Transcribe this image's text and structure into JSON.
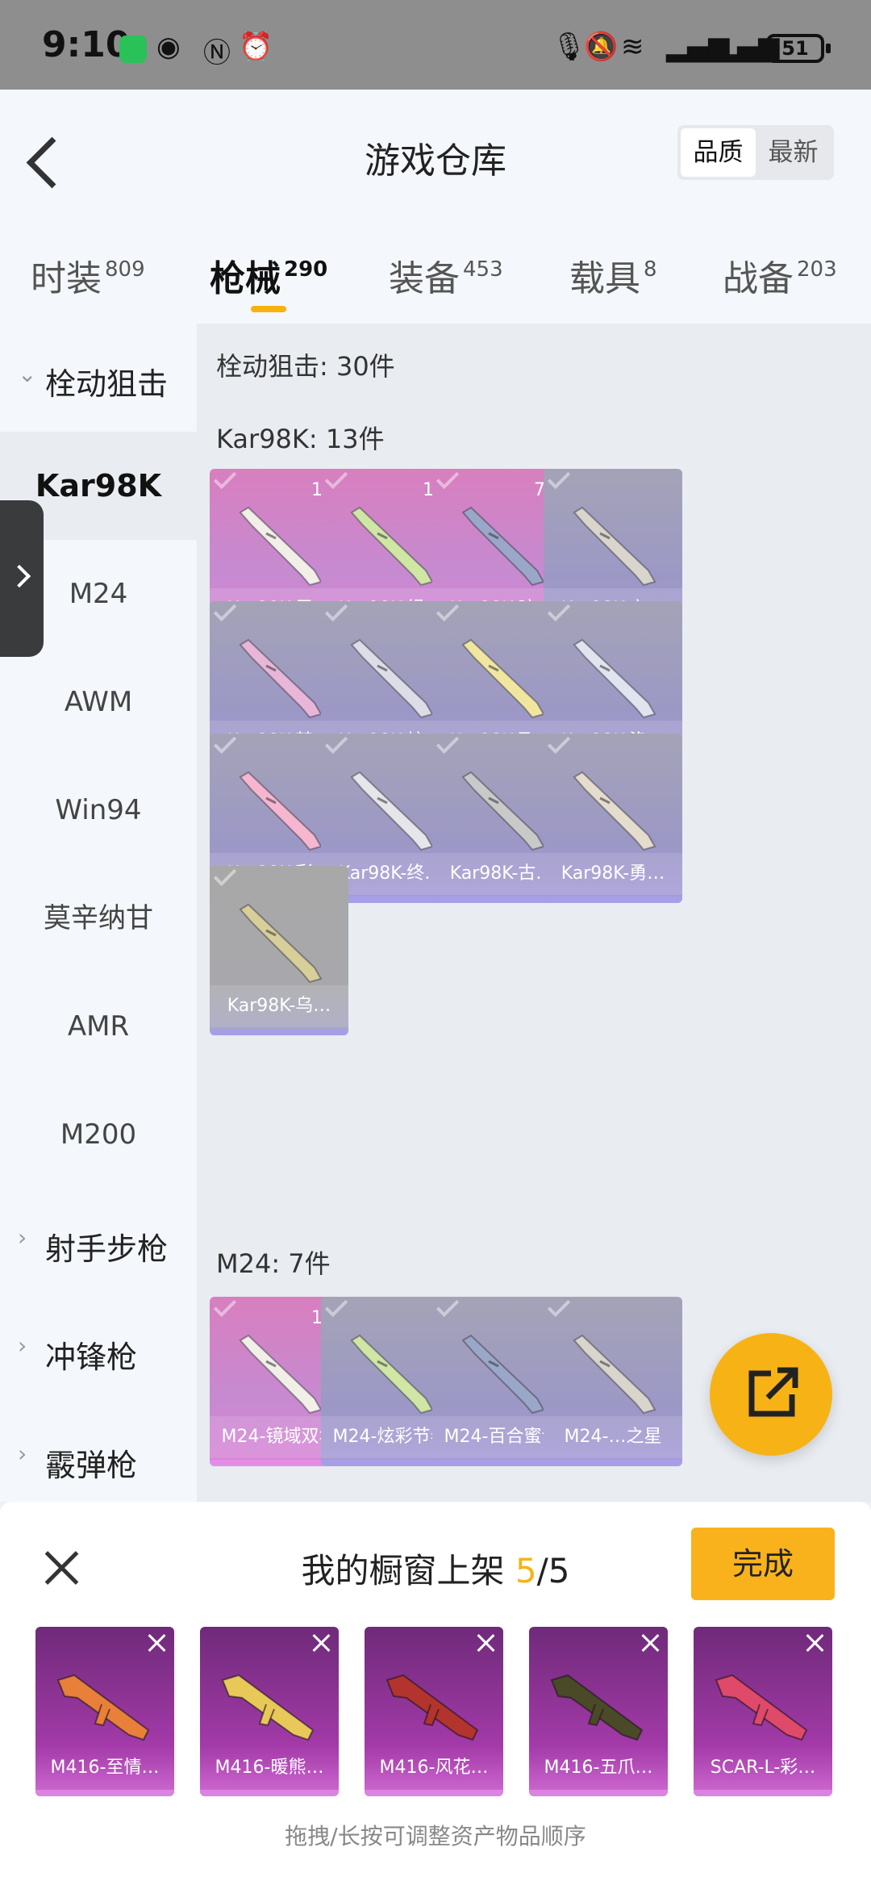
{
  "status_bar": {
    "time": "9:10",
    "battery": "51"
  },
  "header": {
    "title": "游戏仓库",
    "sort": [
      "品质",
      "最新"
    ]
  },
  "tabs": [
    {
      "label": "时装",
      "count": "809"
    },
    {
      "label": "枪械",
      "count": "290"
    },
    {
      "label": "装备",
      "count": "453"
    },
    {
      "label": "载具",
      "count": "8"
    },
    {
      "label": "战备",
      "count": "203"
    }
  ],
  "sidebar": {
    "group_open": "栓动狙击",
    "items": [
      "Kar98K",
      "M24",
      "AWM",
      "Win94",
      "莫辛纳甘",
      "AMR",
      "M200"
    ],
    "groups_closed": [
      "射手步枪",
      "冲锋枪",
      "霰弹枪"
    ]
  },
  "main": {
    "category_header": "栓动狙击: 30件",
    "kar_header": "Kar98K: 13件",
    "m24_header": "M24: 7件",
    "kar_items": [
      {
        "name": "Kar98K-巴…",
        "level": "1级"
      },
      {
        "name": "Kar98K-绿…",
        "level": "1级"
      },
      {
        "name": "Kar98K-暗…",
        "level": "7级"
      },
      {
        "name": "Kar98K-六…",
        "level": ""
      },
      {
        "name": "Kar98K-梦…",
        "level": ""
      },
      {
        "name": "Kar98K-炫…",
        "level": ""
      },
      {
        "name": "Kar98K-飞…",
        "level": ""
      },
      {
        "name": "Kar98K-洛…",
        "level": ""
      },
      {
        "name": "Kar98K-彩…",
        "level": ""
      },
      {
        "name": "Kar98K-终…",
        "level": ""
      },
      {
        "name": "Kar98K-古…",
        "level": ""
      },
      {
        "name": "Kar98K-勇…",
        "level": ""
      },
      {
        "name": "Kar98K-乌…",
        "level": ""
      }
    ],
    "m24_items": [
      {
        "name": "M24-镜域双华",
        "level": "1级"
      },
      {
        "name": "M24-炫彩节奏",
        "level": ""
      },
      {
        "name": "M24-百合蜜语",
        "level": ""
      },
      {
        "name": "M24-…之星",
        "level": ""
      }
    ]
  },
  "showcase": {
    "title_prefix": "我的橱窗上架 ",
    "count": "5",
    "total": "/5",
    "done_label": "完成",
    "slots": [
      "M416-至情…",
      "M416-暖熊…",
      "M416-风花…",
      "M416-五爪…",
      "SCAR-L-彩…"
    ],
    "hint": "拖拽/长按可调整资产物品顺序"
  },
  "colors": {
    "accent": "#f6b30e",
    "done_button": "#f9b21c",
    "pink_card": "#d886d6",
    "purple_card": "#a69ad8"
  }
}
